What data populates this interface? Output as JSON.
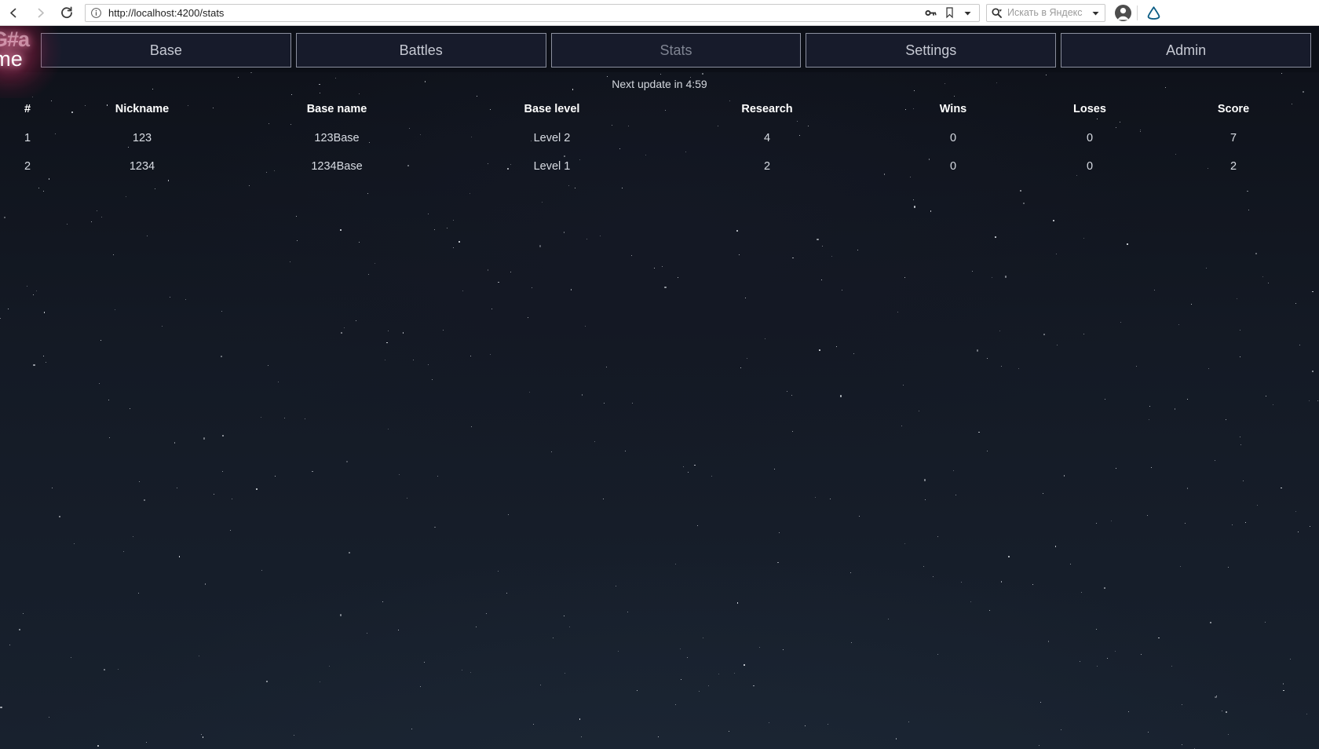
{
  "browser": {
    "back_icon": "chevron-left-icon",
    "forward_icon": "chevron-right-icon",
    "reload_icon": "reload-icon",
    "info_icon": "info-circle-icon",
    "url": "http://localhost:4200/stats",
    "key_icon": "key-icon",
    "bookmark_icon": "bookmark-icon",
    "dropdown_icon": "chevron-down-icon",
    "search_icon": "search-icon",
    "search_placeholder": "Искать в Яндекс",
    "search_dropdown_icon": "chevron-down-icon",
    "avatar_icon": "user-avatar-icon",
    "yandex_icon": "yandex-logo-icon"
  },
  "app": {
    "logo": {
      "line1": "G#a",
      "line2": "me",
      "glow_color": "#ff3c78"
    },
    "tabs": [
      {
        "label": "Base",
        "active": false
      },
      {
        "label": "Battles",
        "active": false
      },
      {
        "label": "Stats",
        "active": true
      },
      {
        "label": "Settings",
        "active": false
      },
      {
        "label": "Admin",
        "active": false
      }
    ],
    "update_notice": "Next update in 4:59",
    "table": {
      "headers": [
        "#",
        "Nickname",
        "Base name",
        "Base level",
        "Research",
        "Wins",
        "Loses",
        "Score"
      ],
      "rows": [
        {
          "num": "1",
          "nickname": "123",
          "base_name": "123Base",
          "base_level": "Level 2",
          "research": "4",
          "wins": "0",
          "loses": "0",
          "score": "7"
        },
        {
          "num": "2",
          "nickname": "1234",
          "base_name": "1234Base",
          "base_level": "Level 1",
          "research": "2",
          "wins": "0",
          "loses": "0",
          "score": "2"
        }
      ]
    },
    "theme": {
      "background": "#141a25",
      "tab_fill": "#171b2b",
      "tab_border": "#8b8f9e",
      "text": "#d9dde4"
    }
  }
}
